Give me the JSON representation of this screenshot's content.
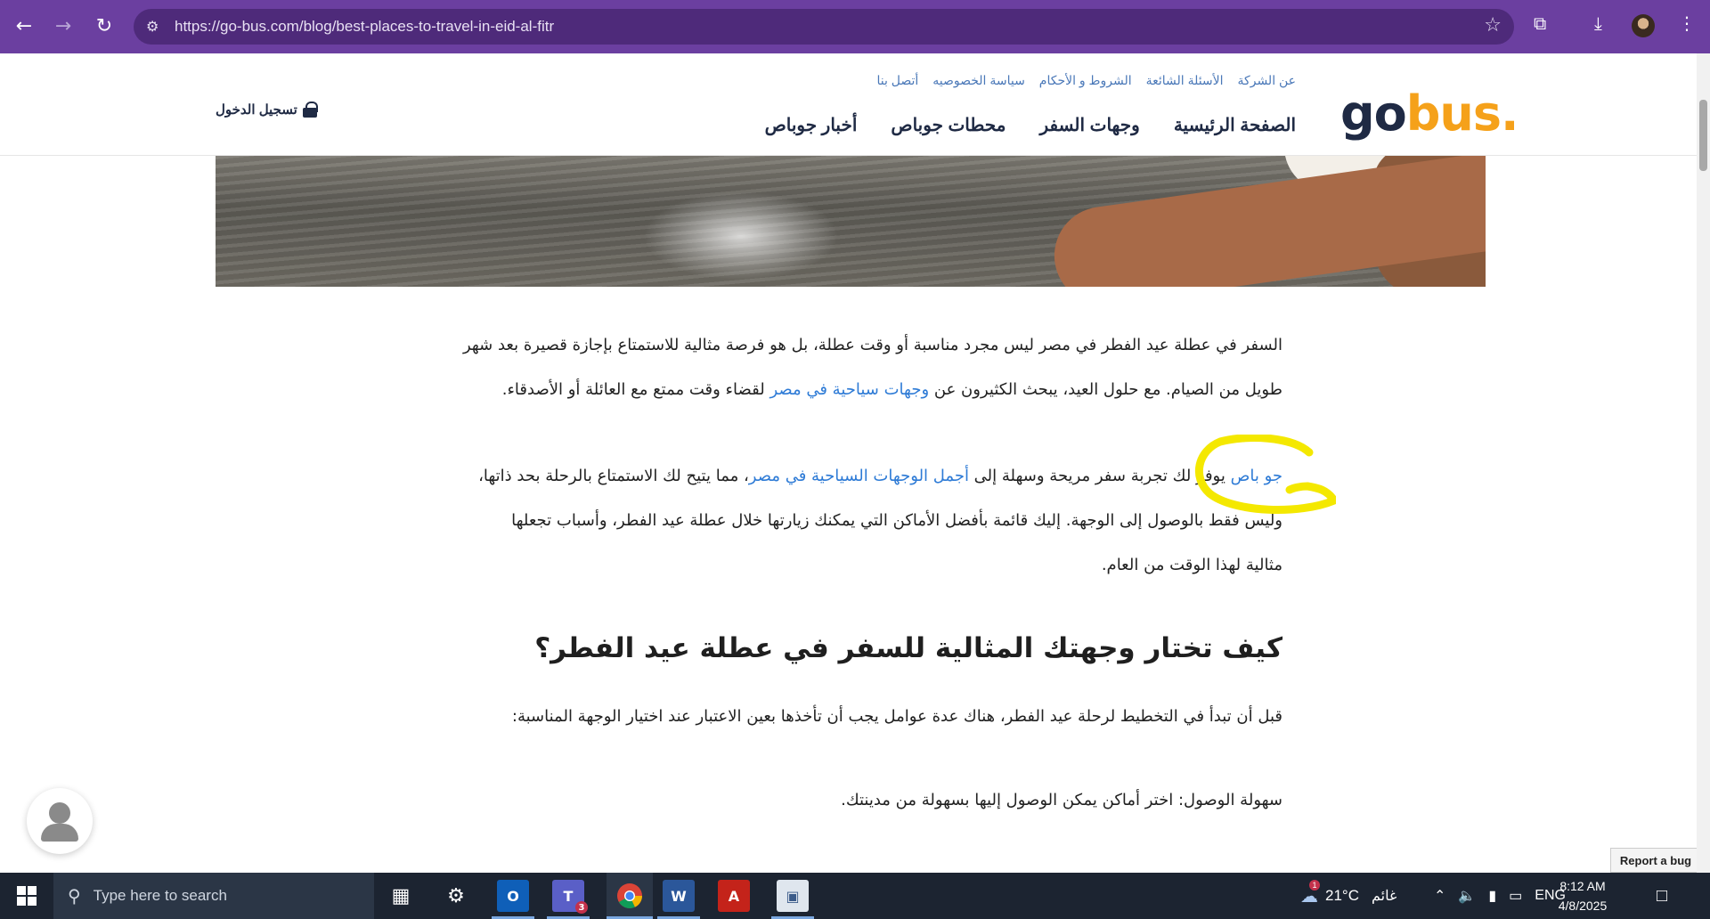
{
  "browser": {
    "url": "https://go-bus.com/blog/best-places-to-travel-in-eid-al-fitr",
    "back_icon": "arrow-left-icon",
    "forward_icon": "arrow-right-icon",
    "reload_icon": "reload-icon"
  },
  "header": {
    "logo_go": "go",
    "logo_bus": "bus.",
    "top_links": [
      "عن الشركة",
      "الأسئلة الشائعة",
      "الشروط و الأحكام",
      "سياسة الخصوصيه",
      "أتصل بنا"
    ],
    "nav": [
      "الصفحة الرئيسية",
      "وجهات السفر",
      "محطات جوباص",
      "أخبار جوباص"
    ],
    "login": "تسجيل الدخول"
  },
  "article": {
    "p1_line1": "السفر في عطلة عيد الفطر في مصر ليس مجرد مناسبة أو وقت عطلة، بل هو فرصة مثالية للاستمتاع بإجازة قصيرة بعد شهر",
    "p1_line2_start": "طويل من الصيام. مع حلول العيد، يبحث الكثيرون عن ",
    "p1_link": "وجهات سياحية في مصر",
    "p1_line2_end": " لقضاء وقت ممتع مع العائلة أو الأصدقاء.",
    "p2_link1": "جو باص",
    "p2_line1_mid": " يوفر لك تجربة سفر مريحة وسهلة إلى ",
    "p2_link2": "أجمل الوجهات السياحية في مصر",
    "p2_line1_end": "، مما يتيح لك الاستمتاع بالرحلة بحد ذاتها،",
    "p2_line2": "وليس فقط بالوصول إلى الوجهة. إليك قائمة بأفضل الأماكن التي يمكنك زيارتها خلال عطلة عيد الفطر، وأسباب تجعلها",
    "p2_line3": "مثالية لهذا الوقت من العام.",
    "heading": "كيف تختار وجهتك المثالية للسفر في عطلة عيد الفطر؟",
    "p3": "قبل أن تبدأ في التخطيط لرحلة عيد الفطر، هناك عدة عوامل يجب أن تأخذها بعين الاعتبار عند اختيار الوجهة المناسبة:",
    "p4": "سهولة الوصول: اختر أماكن يمكن الوصول إليها بسهولة من مدينتك."
  },
  "widgets": {
    "report_bug": "Report a bug"
  },
  "taskbar": {
    "search_placeholder": "Type here to search",
    "weather_temp": "21°C",
    "weather_text": "غائم",
    "lang": "ENG",
    "time": "8:12 AM",
    "date": "4/8/2025",
    "teams_badge": "3",
    "weather_badge": "1"
  }
}
